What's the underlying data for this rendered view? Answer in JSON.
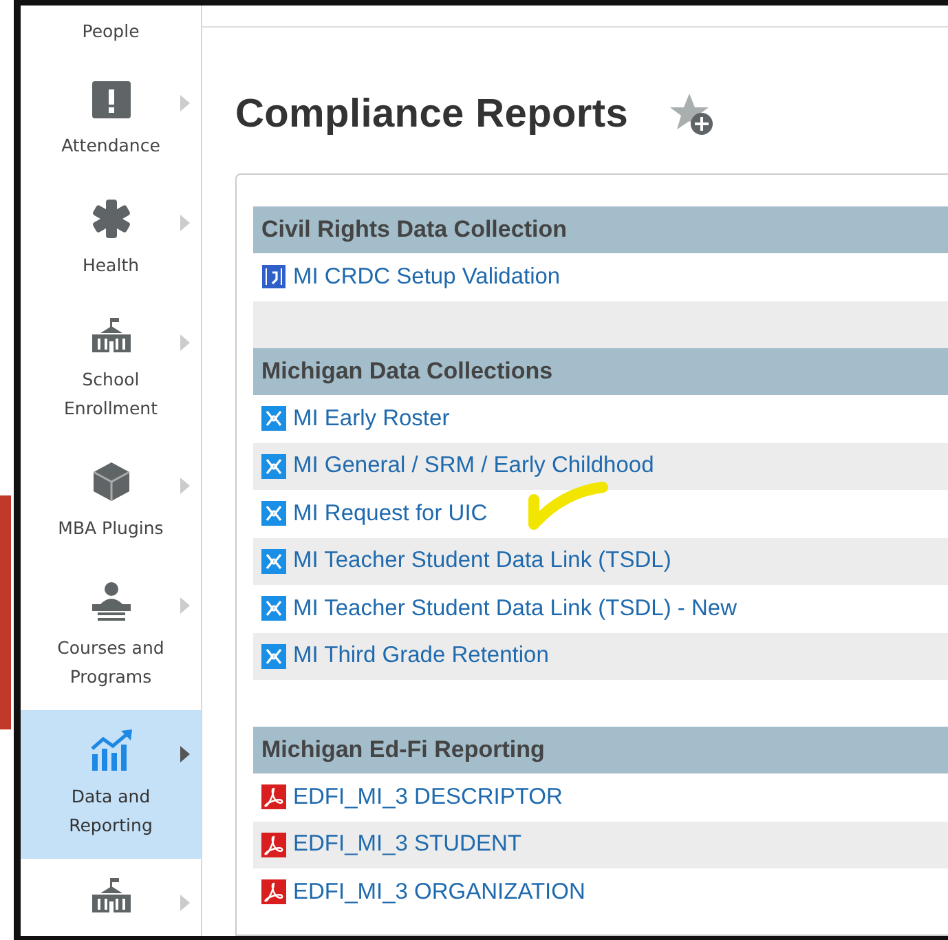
{
  "sidebar": {
    "items": [
      {
        "kind": "people",
        "label": "People",
        "selected": false,
        "arrow": false
      },
      {
        "kind": "attendance",
        "label": "Attendance",
        "selected": false,
        "arrow": true
      },
      {
        "kind": "health",
        "label": "Health",
        "selected": false,
        "arrow": true
      },
      {
        "kind": "school",
        "label": "School Enrollment",
        "selected": false,
        "arrow": true
      },
      {
        "kind": "plugins",
        "label": "MBA Plugins",
        "selected": false,
        "arrow": true
      },
      {
        "kind": "courses",
        "label": "Courses and Programs",
        "selected": false,
        "arrow": true
      },
      {
        "kind": "reporting",
        "label": "Data and Reporting",
        "selected": true,
        "arrow": true
      },
      {
        "kind": "school",
        "selected": false,
        "arrow": true
      }
    ]
  },
  "page": {
    "title": "Compliance Reports"
  },
  "sections": [
    {
      "title": "Civil Rights Data Collection",
      "rows": [
        {
          "kind": "report",
          "label": "MI CRDC Setup Validation"
        },
        {
          "kind": "blank"
        }
      ]
    },
    {
      "title": "Michigan Data Collections",
      "rows": [
        {
          "kind": "xml",
          "label": "MI Early Roster"
        },
        {
          "kind": "xml",
          "label": "MI General / SRM / Early Childhood"
        },
        {
          "kind": "xml",
          "label": "MI Request for UIC"
        },
        {
          "kind": "xml",
          "label": "MI Teacher Student Data Link (TSDL)"
        },
        {
          "kind": "xml",
          "label": "MI Teacher Student Data Link (TSDL) - New"
        },
        {
          "kind": "xml",
          "label": "MI Third Grade Retention"
        }
      ]
    },
    {
      "title": "Michigan Ed-Fi Reporting",
      "rows": [
        {
          "kind": "pdf",
          "label": "EDFI_MI_3 DESCRIPTOR"
        },
        {
          "kind": "pdf",
          "label": "EDFI_MI_3 STUDENT"
        },
        {
          "kind": "pdf",
          "label": "EDFI_MI_3 ORGANIZATION"
        }
      ]
    }
  ]
}
